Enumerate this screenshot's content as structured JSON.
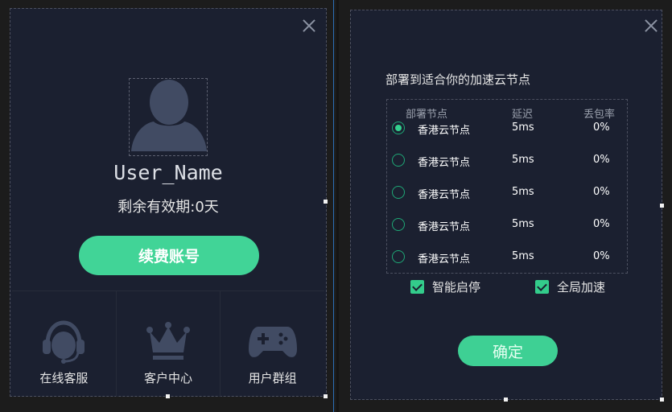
{
  "profile": {
    "username": "User_Name",
    "expiry_label": "剩余有效期:",
    "expiry_value": "0",
    "expiry_unit": "天",
    "renew_label": "续费账号"
  },
  "shortcuts": [
    {
      "label": "在线客服",
      "icon": "headset-icon"
    },
    {
      "label": "客户中心",
      "icon": "crown-icon"
    },
    {
      "label": "用户群组",
      "icon": "gamepad-icon"
    }
  ],
  "nodes": {
    "title": "部署到适合你的加速云节点",
    "headers": {
      "name": "部署节点",
      "latency": "延迟",
      "loss": "丢包率"
    },
    "rows": [
      {
        "name": "香港云节点",
        "latency": "5ms",
        "loss": "0%",
        "selected": true
      },
      {
        "name": "香港云节点",
        "latency": "5ms",
        "loss": "0%",
        "selected": false
      },
      {
        "name": "香港云节点",
        "latency": "5ms",
        "loss": "0%",
        "selected": false
      },
      {
        "name": "香港云节点",
        "latency": "5ms",
        "loss": "0%",
        "selected": false
      },
      {
        "name": "香港云节点",
        "latency": "5ms",
        "loss": "0%",
        "selected": false
      }
    ]
  },
  "options": {
    "smart_start": {
      "label": "智能启停",
      "checked": true
    },
    "global_accel": {
      "label": "全局加速",
      "checked": true
    }
  },
  "confirm_label": "确定",
  "colors": {
    "accent": "#41d497",
    "panel_bg": "#1b2030",
    "icon_fill": "#414b63"
  }
}
